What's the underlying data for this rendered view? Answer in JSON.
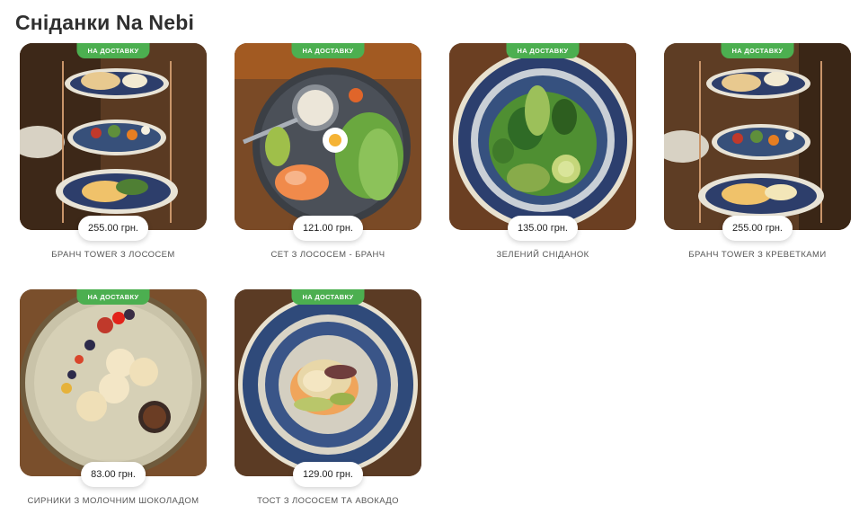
{
  "page": {
    "title": "Сніданки Na Nebi"
  },
  "items": [
    {
      "badge": "НА ДОСТАВКУ",
      "price": "255.00 грн.",
      "name": "БРАНЧ TOWER З ЛОСОСЕМ"
    },
    {
      "badge": "НА ДОСТАВКУ",
      "price": "121.00 грн.",
      "name": "СЕТ З ЛОСОСЕМ - БРАНЧ"
    },
    {
      "badge": "НА ДОСТАВКУ",
      "price": "135.00 грн.",
      "name": "ЗЕЛЕНИЙ СНІДАНОК"
    },
    {
      "badge": "НА ДОСТАВКУ",
      "price": "255.00 грн.",
      "name": "БРАНЧ TOWER З КРЕВЕТКАМИ"
    },
    {
      "badge": "НА ДОСТАВКУ",
      "price": "83.00 грн.",
      "name": "СИРНИКИ З МОЛОЧНИМ ШОКОЛАДОМ"
    },
    {
      "badge": "НА ДОСТАВКУ",
      "price": "129.00 грн.",
      "name": "ТОСТ З ЛОСОСЕМ ТА АВОКАДО"
    }
  ],
  "colors": {
    "badge": "#4caf50",
    "title": "#2f2f2f",
    "name": "#555555"
  }
}
